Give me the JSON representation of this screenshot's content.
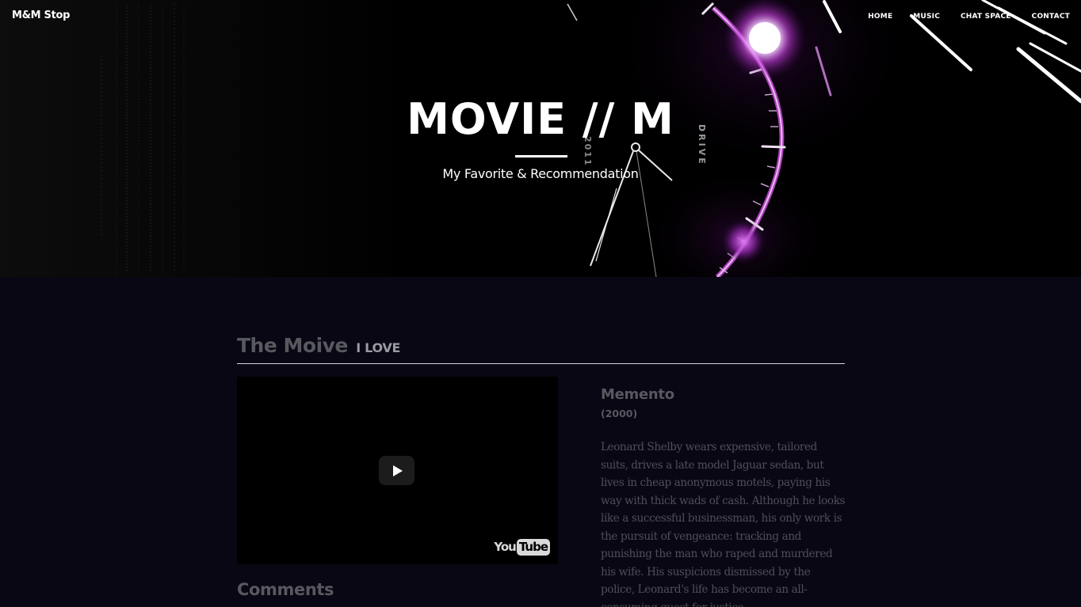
{
  "brand": "M&M Stop",
  "nav": {
    "items": [
      "HOME",
      "MUSIC",
      "CHAT SPACE",
      "CONTACT"
    ]
  },
  "hero": {
    "title": "MOVIE // M",
    "subtitle": "My Favorite & Recommendation",
    "bg_text": [
      "2011",
      "DRIVE"
    ]
  },
  "section": {
    "title": "The Moive",
    "subtitle": "I LOVE"
  },
  "video": {
    "logo_you": "You",
    "logo_tube": "Tube"
  },
  "movie": {
    "title": "Memento",
    "year": "(2000)",
    "description": "Leonard Shelby wears expensive, tailored suits, drives a late model Jaguar sedan, but lives in cheap anonymous motels, paying his way with thick wads of cash. Although he looks like a successful businessman, his only work is the pursuit of vengeance: tracking and punishing the man who raped and murdered his wife. His suspicions dismissed by the police, Leonard's life has become an all-consuming quest for justice."
  },
  "comments": {
    "title": "Comments"
  },
  "colors": {
    "page_bg": "#080713",
    "hero_bg": "#000000",
    "heading": "#58585f",
    "body_text": "#4f4f58",
    "accent_glow": "#d34fe0"
  }
}
